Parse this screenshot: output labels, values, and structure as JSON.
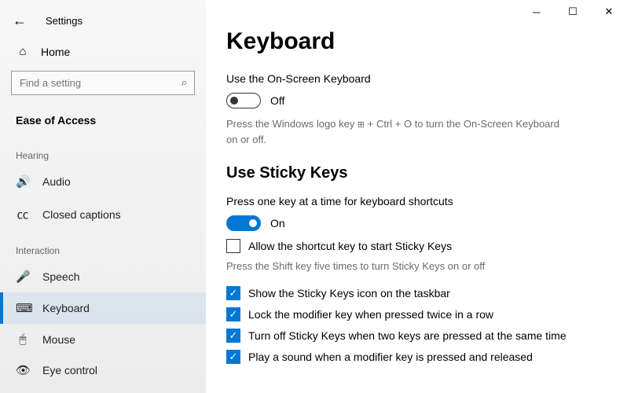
{
  "window": {
    "appname": "Settings"
  },
  "sidebar": {
    "home": "Home",
    "search_placeholder": "Find a setting",
    "category": "Ease of Access",
    "groups": {
      "hearing": "Hearing",
      "interaction": "Interaction"
    },
    "items": {
      "audio": "Audio",
      "closed_captions": "Closed captions",
      "speech": "Speech",
      "keyboard": "Keyboard",
      "mouse": "Mouse",
      "eye_control": "Eye control"
    }
  },
  "main": {
    "title": "Keyboard",
    "osk": {
      "label": "Use the On-Screen Keyboard",
      "state": "Off",
      "hint_pre": "Press the Windows logo key ",
      "hint_post": " + Ctrl + O to turn the On-Screen Keyboard on or off."
    },
    "sticky": {
      "heading": "Use Sticky Keys",
      "label": "Press one key at a time for keyboard shortcuts",
      "state": "On",
      "shortcut_checkbox": "Allow the shortcut key to start Sticky Keys",
      "shortcut_hint": "Press the Shift key five times to turn Sticky Keys on or off",
      "opt_taskbar": "Show the Sticky Keys icon on the taskbar",
      "opt_lock": "Lock the modifier key when pressed twice in a row",
      "opt_turnoff": "Turn off Sticky Keys when two keys are pressed at the same time",
      "opt_sound": "Play a sound when a modifier key is pressed and released"
    }
  }
}
